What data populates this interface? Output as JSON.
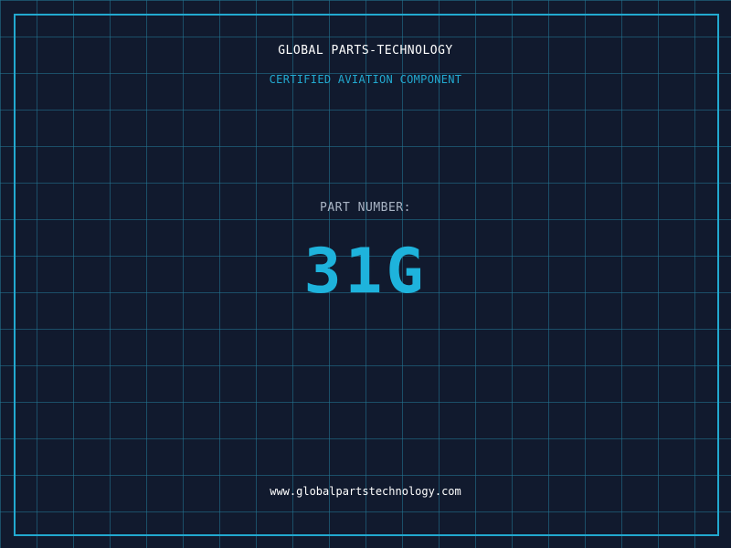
{
  "header": {
    "company": "GLOBAL PARTS-TECHNOLOGY",
    "tagline": "CERTIFIED AVIATION COMPONENT"
  },
  "part": {
    "label": "PART NUMBER:",
    "number": "31G"
  },
  "footer": {
    "website": "www.globalpartstechnology.com"
  },
  "colors": {
    "background": "#111a2e",
    "grid": "#23789a",
    "accent": "#22a9d0",
    "text": "#ffffff",
    "muted": "#a9b4c4"
  }
}
